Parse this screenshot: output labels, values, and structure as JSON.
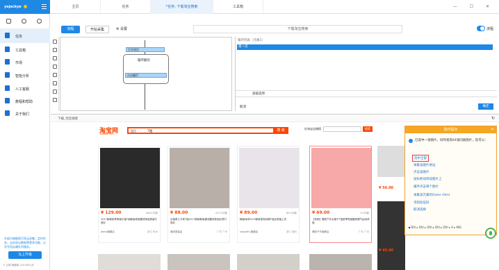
{
  "sidebar": {
    "user": "yejackye",
    "items": [
      {
        "label": "任务",
        "icon": "document-icon",
        "active": true
      },
      {
        "label": "工具箱",
        "icon": "toolbox-icon"
      },
      {
        "label": "市场",
        "icon": "shop-icon"
      },
      {
        "label": "智能分析",
        "icon": "chart-icon"
      },
      {
        "label": "人工客服",
        "icon": "headset-icon"
      },
      {
        "label": "教程和帮助",
        "icon": "book-icon"
      },
      {
        "label": "关于我们",
        "icon": "person-icon"
      }
    ],
    "ad_text": "升级为旗舰版可享云采集，定时任务，自动导出数据等更多功能，以及专用云端队列服务。",
    "upgrade_label": "马上升级",
    "footer": "© 云顾 旗舰版 2021年01月"
  },
  "tabs": [
    {
      "label": "主页"
    },
    {
      "label": "任务"
    },
    {
      "label": "*任务: 下载淘宝搜索",
      "active": true
    },
    {
      "label": "工具箱"
    }
  ],
  "toolbar": {
    "flow_label": "流程",
    "start_label": "开始采集",
    "settings_label": "设置",
    "task_name": "下载淘宝搜索",
    "flowchart_toggle_label": "流程"
  },
  "canvas": {
    "nodes": [
      {
        "label": "打开网页"
      },
      {
        "label": "循环翻页"
      },
      {
        "label": "点击翻页"
      }
    ]
  },
  "right_panel": {
    "title": "循环列表（元素1）",
    "selected_row": "第一页",
    "advanced_label": "高级选项",
    "cancel_label": "取消",
    "ok_label": "确定"
  },
  "browser": {
    "url": "下载_淘宝搜索",
    "logo": "淘宝网",
    "logo_sub": "Taobao.com",
    "search_category": "宝贝",
    "search_query": "T恤",
    "search_button": "搜 索",
    "store_search_label": "在淘宝店铺搜",
    "store_search_button": "搜索"
  },
  "products": [
    {
      "price": "¥ 129.00",
      "sold": "406人付款",
      "title": "2017新款秋季男装长袖T恤韩版修身圆领体恤男装打底衫",
      "shop": "jeans旗舰店",
      "loc": "浙江 杭州"
    },
    {
      "price": "¥ 88.00",
      "sold": "227人付款",
      "title": "长袖男士卡其T恤2017新款韩版潮流圆领体恤衫男打底衫",
      "shop": "潮流男装店",
      "loc": "广东 广州"
    },
    {
      "price": "¥ 89.00",
      "sold": "89人付款",
      "title": "韩版休闲2019新款宽松纯棉T恤女短袖上衣",
      "shop": "casualfu 旗舰店",
      "loc": "浙江 湖州"
    },
    {
      "price": "¥ 69.00",
      "sold": "3人付款",
      "title": "【热销】骆驼户外女速干T恤夏季短袖圆领透气运动体恤",
      "shop": "骆驼户外旗舰店",
      "loc": "广东 广州"
    }
  ],
  "side_prices": [
    "¥ 45.00",
    "¥ 56.00"
  ],
  "tips": {
    "title": "操作提示",
    "message": "已选中一张图片，同时发现44张同类图片，您可以：",
    "actions": [
      "选中全部",
      "采集该图片地址",
      "点击该图片",
      "鼠标移动到该图片上",
      "循环点击每个图片",
      "采集该元素的Outer Html",
      "识别验证码",
      "取消选择"
    ],
    "breadcrumb": "◀ DIV ▸ DIV ▸ DIV ▸ DIV ▸ DIV ▸ A ▸ IMG"
  }
}
